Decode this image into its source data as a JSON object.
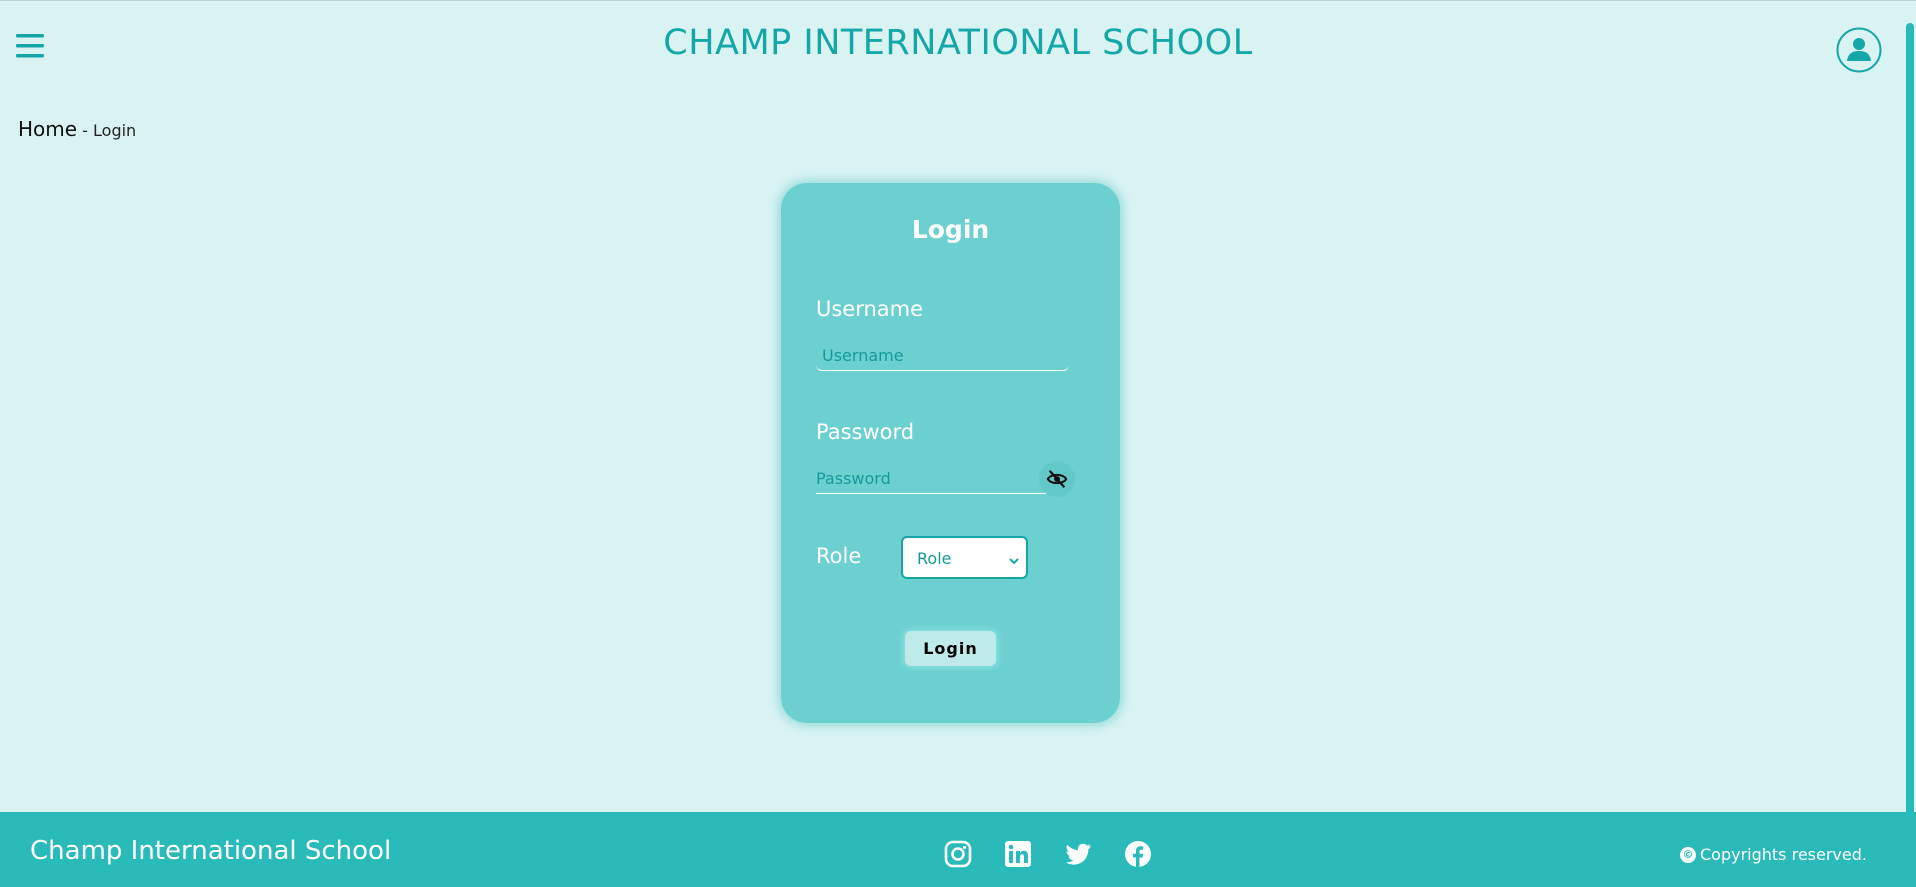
{
  "header": {
    "title": "CHAMP INTERNATIONAL SCHOOL",
    "menu_icon": "hamburger-menu-icon",
    "profile_icon": "user-circle-icon"
  },
  "breadcrumb": {
    "home": "Home",
    "separator_current": "- Login"
  },
  "login_card": {
    "title": "Login",
    "username_label": "Username",
    "username_placeholder": "Username",
    "password_label": "Password",
    "password_placeholder": "Password",
    "password_toggle_icon": "eye-slash-icon",
    "role_label": "Role",
    "role_selected": "Role",
    "submit_label": "Login"
  },
  "footer": {
    "brand": "Champ International School",
    "social_icons": [
      "instagram-icon",
      "linkedin-icon",
      "twitter-icon",
      "facebook-icon"
    ],
    "copyright": "Copyrights reserved."
  },
  "colors": {
    "page_bg": "#d9f3f3",
    "accent": "#15a7a7",
    "card_bg": "#6dd0d0",
    "footer_bg": "#2bbaba"
  }
}
